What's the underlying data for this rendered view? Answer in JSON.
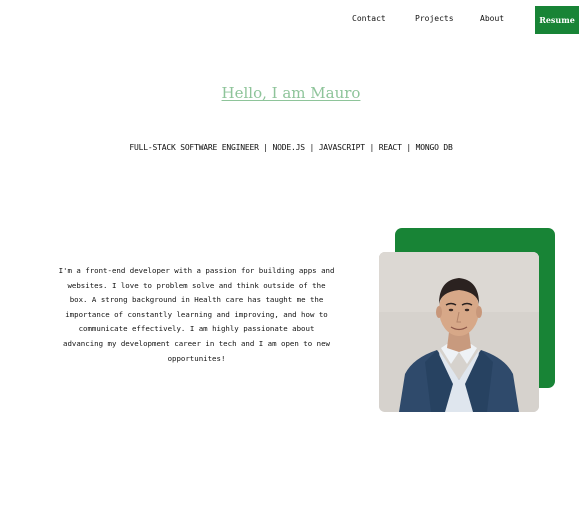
{
  "nav": {
    "items": [
      {
        "label": "Contact"
      },
      {
        "label": "Projects"
      },
      {
        "label": "About"
      }
    ],
    "resume_label": "Resume"
  },
  "hero": {
    "title": "Hello, I am Mauro",
    "subtitle": "FULL-STACK SOFTWARE ENGINEER | NODE.JS | JAVASCRIPT | REACT | MONGO DB"
  },
  "about": {
    "bio": "I'm a front-end developer with a passion for building apps and websites. I love to problem solve and think outside of the box. A strong background in Health care has taught me the importance of constantly learning and improving, and how to communicate effectively. I am highly passionate about advancing my development career in tech and I am open to new opportunites!"
  },
  "colors": {
    "accent": "#188436",
    "title": "#8ec49a"
  }
}
